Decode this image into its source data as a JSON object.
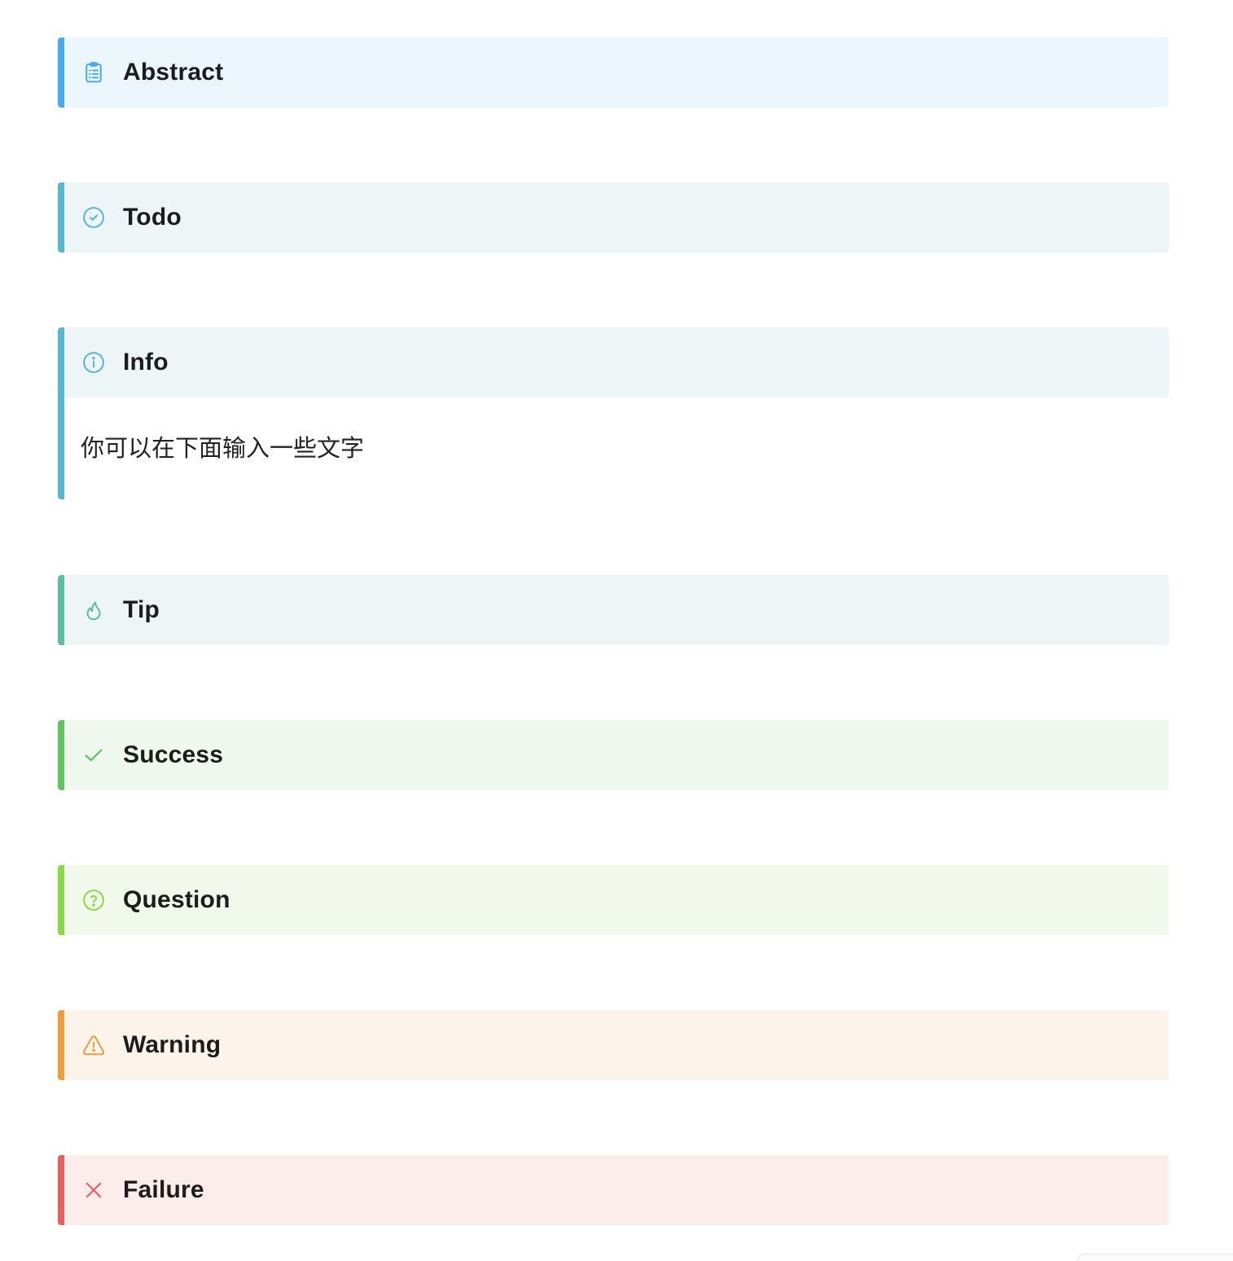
{
  "callouts": [
    {
      "key": "abstract",
      "title": "Abstract",
      "icon": "clipboard-list-icon",
      "accent": "#4aa8ef",
      "bg": "#ebf6fd",
      "expanded": false
    },
    {
      "key": "todo",
      "title": "Todo",
      "icon": "check-circle-icon",
      "accent": "#55b8cc",
      "bg": "#edf5f7",
      "expanded": false
    },
    {
      "key": "info",
      "title": "Info",
      "icon": "info-circle-icon",
      "accent": "#55b8cc",
      "bg": "#edf5f7",
      "expanded": true,
      "body": "你可以在下面输入一些文字"
    },
    {
      "key": "tip",
      "title": "Tip",
      "icon": "flame-icon",
      "accent": "#5bbfa0",
      "bg": "#edf6f4",
      "expanded": false
    },
    {
      "key": "success",
      "title": "Success",
      "icon": "checkmark-icon",
      "accent": "#62c45f",
      "bg": "#eef8ee",
      "expanded": false
    },
    {
      "key": "question",
      "title": "Question",
      "icon": "question-circle-icon",
      "accent": "#8ad946",
      "bg": "#f2f9ec",
      "expanded": false
    },
    {
      "key": "warning",
      "title": "Warning",
      "icon": "warning-triangle-icon",
      "accent": "#ef9c3c",
      "bg": "#fcf3ea",
      "expanded": false
    },
    {
      "key": "failure",
      "title": "Failure",
      "icon": "close-x-icon",
      "accent": "#e8605e",
      "bg": "#fcedec",
      "expanded": false
    }
  ]
}
